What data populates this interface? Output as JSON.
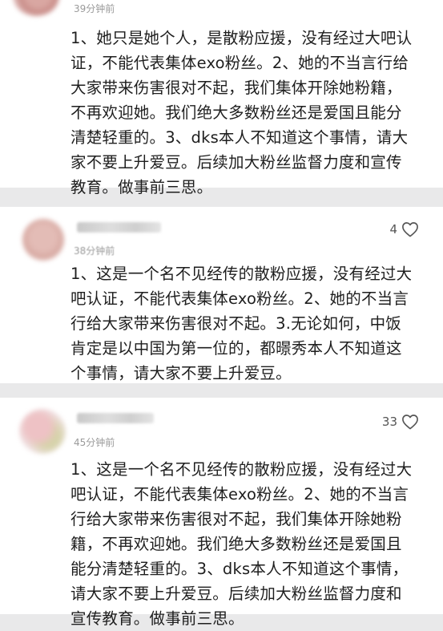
{
  "comments": [
    {
      "author": "",
      "time": "39分钟前",
      "likes": "",
      "lines": [
        "1、她只是她个人，是散粉应援，没有经过大吧认",
        "证，不能代表集体exo粉丝。2、她的不当言行给",
        "大家带来伤害很对不起，我们集体开除她粉籍，",
        "不再欢迎她。我们绝大多数粉丝还是爱国且能分",
        "清楚轻重的。3、dks本人不知道这个事情，请大",
        "家不要上升爱豆。后续加大粉丝监督力度和宣传",
        "教育。做事前三思。"
      ]
    },
    {
      "author": "",
      "time": "38分钟前",
      "likes": "4",
      "lines": [
        "1、这是一个名不见经传的散粉应援，没有经过大",
        "吧认证，不能代表集体exo粉丝。2、她的不当言",
        "行给大家带来伤害很对不起。3.无论如何，中饭",
        "肯定是以中国为第一位的，都暻秀本人不知道这",
        "个事情，请大家不要上升爱豆。"
      ]
    },
    {
      "author": "",
      "time": "45分钟前",
      "likes": "33",
      "lines": [
        "1、这是一个名不见经传的散粉应援，没有经过大",
        "吧认证，不能代表集体exo粉丝。2、她的不当言",
        "行给大家带来伤害很对不起，我们集体开除她粉",
        "籍，不再欢迎她。我们绝大多数粉丝还是爱国且",
        "能分清楚轻重的。3、dks本人不知道这个事情，",
        "请大家不要上升爱豆。后续加大粉丝监督力度和",
        "宣传教育。做事前三思。"
      ]
    }
  ],
  "icons": {
    "like": "heart-outline-icon"
  }
}
